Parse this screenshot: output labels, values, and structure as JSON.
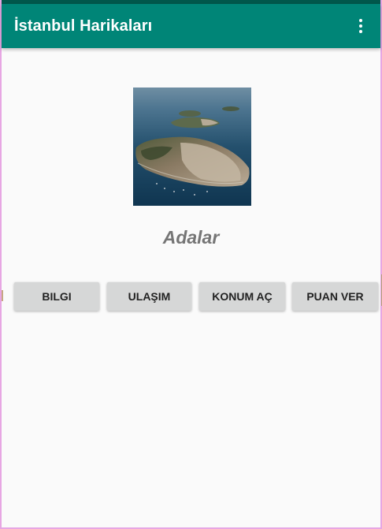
{
  "app_bar": {
    "title": "İstanbul Harikaları"
  },
  "main": {
    "place_name": "Adalar",
    "image_subject": "aerial view of Princes' Islands"
  },
  "buttons": {
    "info": "BILGI",
    "transport": "ULAŞIM",
    "location": "KONUM AÇ",
    "rate": "PUAN VER"
  },
  "colors": {
    "primary": "#008577",
    "primary_dark": "#00574b",
    "button_bg": "#d6d7d7",
    "place_name_text": "#757575"
  },
  "icons": {
    "overflow": "more-vert-icon"
  }
}
